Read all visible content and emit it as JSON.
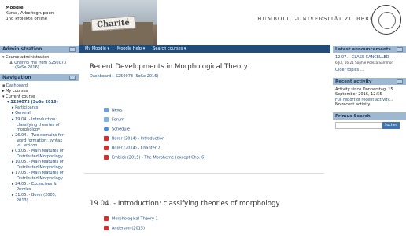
{
  "site": {
    "title": "Moodle",
    "subtitle_line1": "Kurse, Arbeitsgruppen",
    "subtitle_line2": "und Projekte online"
  },
  "banner": {
    "sign_text": "Charité"
  },
  "university": {
    "name": "HUMBOLDT-UNIVERSITÄT ZU BERLIN"
  },
  "navbar": {
    "items": [
      "My Moodle ▾",
      "Moodle Help ▾",
      "Search courses ▾"
    ]
  },
  "admin": {
    "heading": "Administration",
    "course_admin": "Course administration",
    "unenrol_line1": "Unenrol me from S250073",
    "unenrol_line2": "(SoSe 2016)"
  },
  "navigation": {
    "heading": "Navigation",
    "dashboard": "Dashboard",
    "my_courses": "My courses",
    "current_course": "Current course",
    "course": "S250073 (SoSe 2016)",
    "participants": "Participants",
    "general": "General",
    "topics": [
      [
        "19.04. - Introduction:",
        "classifying theories of",
        "morphology"
      ],
      [
        "26.04. - Two domains for",
        "word formation: syntax",
        "vs. lexicon"
      ],
      [
        "03.05. - Main features of",
        "Distributed Morphology"
      ],
      [
        "10.05. - Main features of",
        "Distributed Morphology"
      ],
      [
        "17.05. - Main features of",
        "Distributed Morphology"
      ],
      [
        "24.05. - Excercises &",
        "Puzzles"
      ],
      [
        "31.05. - Borer (2005,",
        "2013)"
      ]
    ]
  },
  "main": {
    "title": "Recent Developments in Morphological Theory",
    "breadcrumb": "Dashboard  ▸  S250073 (SoSe 2016)",
    "activities": [
      "News",
      "Forum",
      "Schedule",
      "Borer (2014) - Introduction",
      "Borer (2014) - Chapter 7",
      "Embick (2015) - The Morpheme (except Chp. 6)"
    ],
    "section_title": "19.04. - Introduction: classifying theories of morphology",
    "section_items": [
      "Morphological Theory 1",
      "Anderson (2015)"
    ]
  },
  "announcements": {
    "heading": "Latest announcements",
    "item_title": "12.07. - CLASS CANCELLED",
    "item_meta": "6 Jul, 16:21  Sophie Poleza Sammon",
    "older": "Older topics ..."
  },
  "recent": {
    "heading": "Recent activity",
    "since_line1": "Activity since Donnerstag, 15",
    "since_line2": "September 2016, 12:55",
    "full_report": "Full report of recent activity...",
    "none": "No recent activity"
  },
  "primus": {
    "heading": "Primus Search",
    "button": "Suchen"
  },
  "colors": {
    "accent": "#1f4c7a",
    "block_head": "#9fb8d2",
    "pdf_red": "#d32f2f"
  }
}
